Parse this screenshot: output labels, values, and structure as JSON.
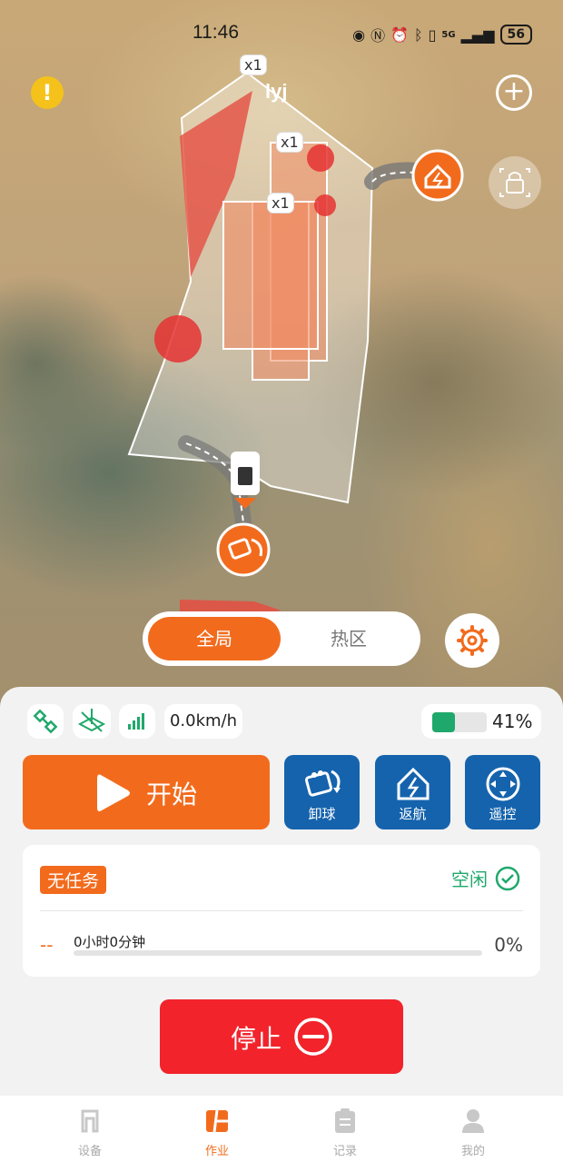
{
  "status_bar": {
    "time": "11:46",
    "battery": "56",
    "network": "5G"
  },
  "map": {
    "zone_label": "lyj",
    "multipliers": [
      "x1",
      "x1",
      "x1"
    ],
    "view_toggle": {
      "options": [
        "全局",
        "热区"
      ],
      "selected": "全局"
    }
  },
  "panel": {
    "speed": "0.0km/h",
    "battery_percent": "41%",
    "battery_level": 0.41,
    "start_label": "开始",
    "actions": [
      {
        "label": "卸球",
        "icon": "ball-unload-icon"
      },
      {
        "label": "返航",
        "icon": "return-home-icon"
      },
      {
        "label": "遥控",
        "icon": "remote-control-icon"
      }
    ],
    "task": {
      "tag": "无任务",
      "state": "空闲",
      "dash": "--",
      "elapsed": "0小时0分钟",
      "progress": "0%",
      "progress_value": 0
    },
    "stop_label": "停止"
  },
  "tabs": [
    {
      "label": "设备",
      "icon": "device-icon",
      "active": false
    },
    {
      "label": "作业",
      "icon": "work-icon",
      "active": true
    },
    {
      "label": "记录",
      "icon": "record-icon",
      "active": false
    },
    {
      "label": "我的",
      "icon": "profile-icon",
      "active": false
    }
  ],
  "colors": {
    "accent": "#f26b1d",
    "primary_blue": "#1563ad",
    "stop_red": "#f2232b",
    "ok_green": "#1fa86b",
    "warn_yellow": "#f4c21a"
  }
}
